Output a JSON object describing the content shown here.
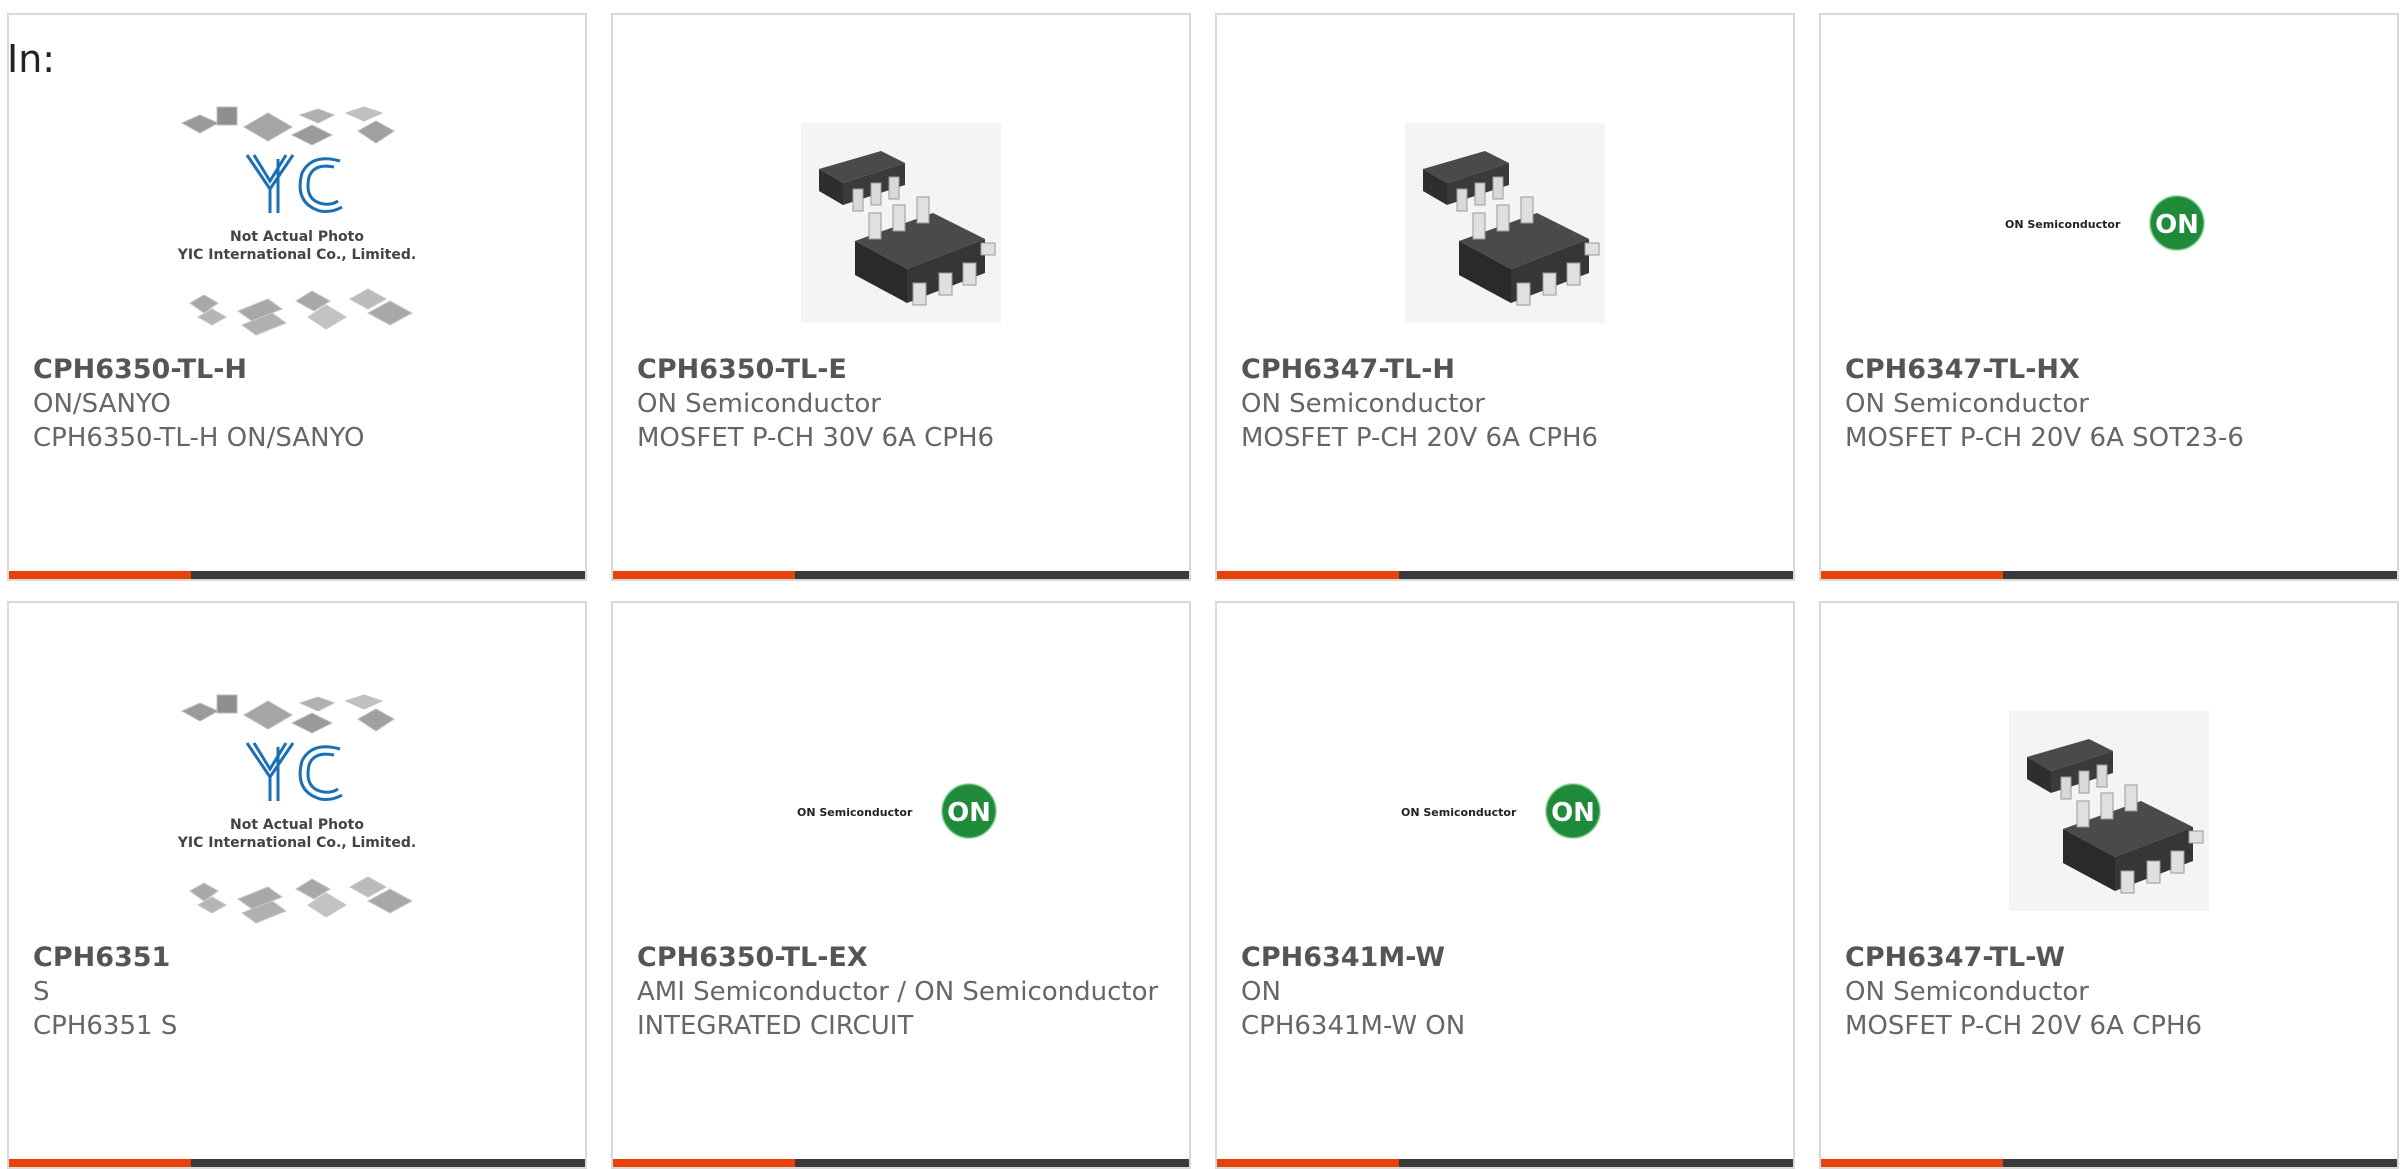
{
  "page": {
    "heading": "In:"
  },
  "photo_placeholder": {
    "line1": "Not Actual Photo",
    "line2": "YIC International Co., Limited.",
    "logo_text": "YIC"
  },
  "brand_logo": {
    "text": "ON Semiconductor",
    "badge": "ON"
  },
  "colors": {
    "accent": "#e8410b",
    "bar": "#3a3a3a",
    "border": "#d9d9d9",
    "on_green": "#1f8a3a"
  },
  "products": [
    {
      "part": "CPH6350-TL-H",
      "maker": "ON/SANYO",
      "desc": "CPH6350-TL-H ON/SANYO",
      "image": "not-actual-photo"
    },
    {
      "part": "CPH6350-TL-E",
      "maker": "ON Semiconductor",
      "desc": "MOSFET P-CH 30V 6A CPH6",
      "image": "chip-photo"
    },
    {
      "part": "CPH6347-TL-H",
      "maker": "ON Semiconductor",
      "desc": "MOSFET P-CH 20V 6A CPH6",
      "image": "chip-photo"
    },
    {
      "part": "CPH6347-TL-HX",
      "maker": "ON Semiconductor",
      "desc": "MOSFET P-CH 20V 6A SOT23-6",
      "image": "on-logo"
    },
    {
      "part": "CPH6351",
      "maker": "S",
      "desc": "CPH6351 S",
      "image": "not-actual-photo"
    },
    {
      "part": "CPH6350-TL-EX",
      "maker": "AMI Semiconductor / ON Semiconductor",
      "desc": "INTEGRATED CIRCUIT",
      "image": "on-logo"
    },
    {
      "part": "CPH6341M-W",
      "maker": "ON",
      "desc": "CPH6341M-W ON",
      "image": "on-logo"
    },
    {
      "part": "CPH6347-TL-W",
      "maker": "ON Semiconductor",
      "desc": "MOSFET P-CH 20V 6A CPH6",
      "image": "chip-photo"
    }
  ]
}
